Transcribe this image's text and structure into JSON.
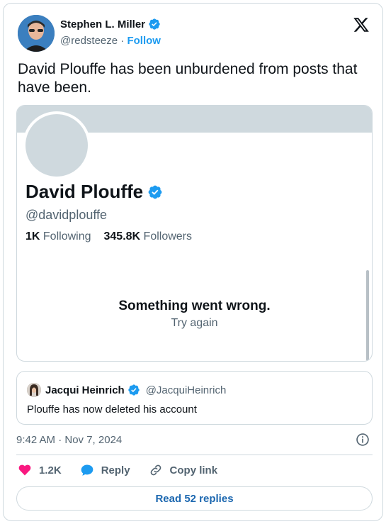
{
  "author": {
    "name": "Stephen L. Miller",
    "handle": "@redsteeze",
    "separator": "·",
    "follow_label": "Follow"
  },
  "tweet": {
    "text": "David Plouffe has been unburdened from posts that have been."
  },
  "embedded_profile": {
    "name": "David Plouffe",
    "handle": "@davidplouffe",
    "following_count": "1K",
    "following_label": "Following",
    "followers_count": "345.8K",
    "followers_label": "Followers",
    "error_title": "Something went wrong.",
    "error_retry": "Try again"
  },
  "quote": {
    "name": "Jacqui Heinrich",
    "handle": "@JacquiHeinrich",
    "text": "Plouffe has now deleted his account"
  },
  "meta": {
    "timestamp": "9:42 AM · Nov 7, 2024"
  },
  "actions": {
    "like_count": "1.2K",
    "reply_label": "Reply",
    "copy_label": "Copy link",
    "read_replies_label": "Read 52 replies"
  },
  "colors": {
    "accent": "#1d9bf0",
    "like": "#f91880",
    "border": "#cfd9de",
    "muted": "#536471"
  },
  "icons": [
    "x-logo-icon",
    "verified-badge-icon",
    "info-icon",
    "heart-icon",
    "reply-bubble-icon",
    "link-icon"
  ]
}
